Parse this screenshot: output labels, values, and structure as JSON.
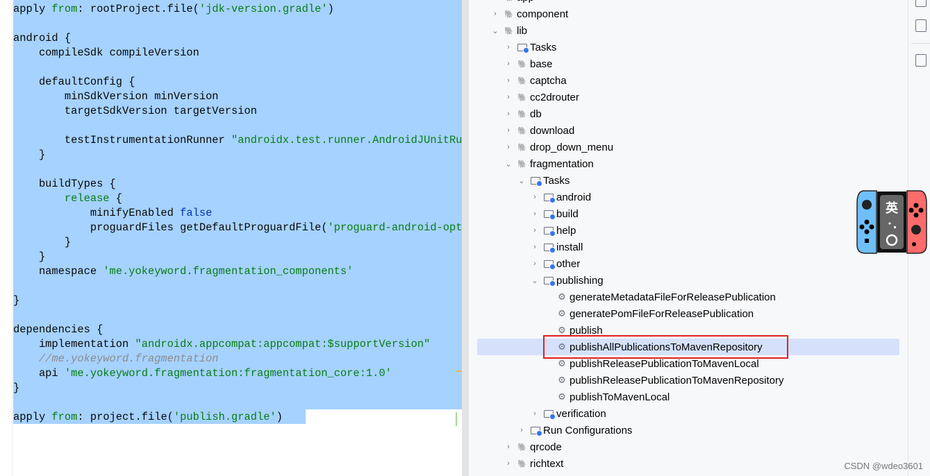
{
  "editor": {
    "lines": [
      [
        [
          "apply ",
          ""
        ],
        [
          "from",
          ".kw"
        ],
        [
          ": rootProject.file(",
          ""
        ],
        [
          "'jdk-version.gradle'",
          "str"
        ],
        [
          ")",
          ""
        ]
      ],
      [],
      [
        [
          "android {",
          ""
        ]
      ],
      [
        [
          "    compileSdk compileVersion",
          ""
        ]
      ],
      [],
      [
        [
          "    defaultConfig {",
          ""
        ]
      ],
      [
        [
          "        minSdkVersion minVersion",
          ""
        ]
      ],
      [
        [
          "        targetSdkVersion targetVersion",
          ""
        ]
      ],
      [],
      [
        [
          "        testInstrumentationRunner ",
          ""
        ],
        [
          "\"androidx.test.runner.AndroidJUnitRunner\"",
          "str"
        ]
      ],
      [
        [
          "    }",
          ""
        ]
      ],
      [],
      [
        [
          "    buildTypes {",
          ""
        ]
      ],
      [
        [
          "        ",
          ""
        ],
        [
          "release",
          "str"
        ],
        [
          " {",
          ""
        ]
      ],
      [
        [
          "            minifyEnabled ",
          ""
        ],
        [
          "false",
          "kb"
        ]
      ],
      [
        [
          "            proguardFiles getDefaultProguardFile(",
          ""
        ],
        [
          "'proguard-android-optimize.txt'",
          "str"
        ]
      ],
      [
        [
          "        }",
          ""
        ]
      ],
      [
        [
          "    }",
          ""
        ]
      ],
      [
        [
          "    namespace ",
          ""
        ],
        [
          "'me.yokeyword.fragmentation_components'",
          "str"
        ]
      ],
      [],
      [
        [
          "}",
          ""
        ]
      ],
      [],
      [
        [
          "dependencies {",
          ""
        ]
      ],
      [
        [
          "    implementation ",
          ""
        ],
        [
          "\"androidx.appcompat:appcompat:$supportVersion\"",
          "str"
        ]
      ],
      [
        [
          "    //me.yokeyword.fragmentation",
          "cm"
        ]
      ],
      [
        [
          "    api ",
          ""
        ],
        [
          "'me.yokeyword.fragmentation:fragmentation_core:1.0'",
          "str"
        ]
      ],
      [
        [
          "}",
          ""
        ]
      ],
      [],
      [
        [
          "apply ",
          ""
        ],
        [
          "from",
          "kw"
        ],
        [
          ": project.file(",
          ""
        ],
        [
          "'publish.gradle'",
          "str"
        ],
        [
          ")",
          ""
        ]
      ]
    ]
  },
  "tree": {
    "items": [
      {
        "label": "app",
        "level": 0,
        "chev": "",
        "icon": "gradle-module-icon"
      },
      {
        "label": "component",
        "level": 0,
        "chev": "›",
        "icon": "gradle-module-icon"
      },
      {
        "label": "lib",
        "level": 0,
        "chev": "⌄",
        "icon": "gradle-module-icon"
      },
      {
        "label": "Tasks",
        "level": 1,
        "chev": "›",
        "icon": "task-folder-icon"
      },
      {
        "label": "base",
        "level": 1,
        "chev": "›",
        "icon": "gradle-module-icon"
      },
      {
        "label": "captcha",
        "level": 1,
        "chev": "›",
        "icon": "gradle-module-icon"
      },
      {
        "label": "cc2drouter",
        "level": 1,
        "chev": "›",
        "icon": "gradle-module-icon"
      },
      {
        "label": "db",
        "level": 1,
        "chev": "›",
        "icon": "gradle-module-icon"
      },
      {
        "label": "download",
        "level": 1,
        "chev": "›",
        "icon": "gradle-module-icon"
      },
      {
        "label": "drop_down_menu",
        "level": 1,
        "chev": "›",
        "icon": "gradle-module-icon"
      },
      {
        "label": "fragmentation",
        "level": 1,
        "chev": "⌄",
        "icon": "gradle-module-icon"
      },
      {
        "label": "Tasks",
        "level": 2,
        "chev": "⌄",
        "icon": "task-folder-icon"
      },
      {
        "label": "android",
        "level": 3,
        "chev": "›",
        "icon": "task-folder-icon"
      },
      {
        "label": "build",
        "level": 3,
        "chev": "›",
        "icon": "task-folder-icon"
      },
      {
        "label": "help",
        "level": 3,
        "chev": "›",
        "icon": "task-folder-icon"
      },
      {
        "label": "install",
        "level": 3,
        "chev": "›",
        "icon": "task-folder-icon"
      },
      {
        "label": "other",
        "level": 3,
        "chev": "›",
        "icon": "task-folder-icon"
      },
      {
        "label": "publishing",
        "level": 3,
        "chev": "⌄",
        "icon": "task-folder-icon"
      },
      {
        "label": "generateMetadataFileForReleasePublication",
        "level": 4,
        "chev": "",
        "icon": "gear-icon"
      },
      {
        "label": "generatePomFileForReleasePublication",
        "level": 4,
        "chev": "",
        "icon": "gear-icon"
      },
      {
        "label": "publish",
        "level": 4,
        "chev": "",
        "icon": "gear-icon"
      },
      {
        "label": "publishAllPublicationsToMavenRepository",
        "level": 4,
        "chev": "",
        "icon": "gear-icon",
        "selected": true
      },
      {
        "label": "publishReleasePublicationToMavenLocal",
        "level": 4,
        "chev": "",
        "icon": "gear-icon"
      },
      {
        "label": "publishReleasePublicationToMavenRepository",
        "level": 4,
        "chev": "",
        "icon": "gear-icon"
      },
      {
        "label": "publishToMavenLocal",
        "level": 4,
        "chev": "",
        "icon": "gear-icon"
      },
      {
        "label": "verification",
        "level": 3,
        "chev": "›",
        "icon": "task-folder-icon"
      },
      {
        "label": "Run Configurations",
        "level": 2,
        "chev": "›",
        "icon": "task-folder-icon"
      },
      {
        "label": "qrcode",
        "level": 1,
        "chev": "›",
        "icon": "gradle-module-icon"
      },
      {
        "label": "richtext",
        "level": 1,
        "chev": "›",
        "icon": "gradle-module-icon"
      }
    ]
  },
  "ime": {
    "label": "英"
  },
  "watermark": "CSDN @wdeo3601"
}
